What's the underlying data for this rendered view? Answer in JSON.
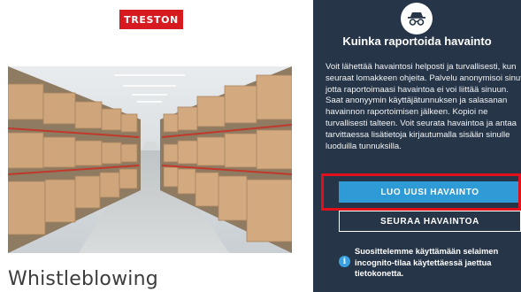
{
  "brand": {
    "logo_text": "TRESTON",
    "logo_color": "#d71920"
  },
  "left": {
    "page_title": "Whistleblowing",
    "photo_icon": "warehouse-photo"
  },
  "panel": {
    "icon": "incognito-icon",
    "title": "Kuinka raportoida havainto",
    "description": "Voit lähettää havaintosi helposti ja turvallisesti, kun seuraat lomakkeen ohjeita. Palvelu anonymisoi sinut, jotta raportoimaasi havaintoa ei voi liittää sinuun. Saat anonyymin käyttäjätunnuksen ja salasanan havainnon raportoimisen jälkeen. Kopioi ne turvallisesti talteen. Voit seurata havaintoa ja antaa tarvittaessa lisätietoja kirjautumalla sisään sinulle luoduilla tunnuksilla.",
    "new_report_label": "LUO UUSI HAVAINTO",
    "follow_report_label": "SEURAA HAVAINTOA",
    "info_icon": "info-icon",
    "info_text": "Suosittelemme käyttämään selaimen incognito-tilaa käytettäessä jaettua tietokonetta.",
    "colors": {
      "background": "#263547",
      "primary_button": "#2f9bd6",
      "highlight": "#e3101c"
    }
  }
}
